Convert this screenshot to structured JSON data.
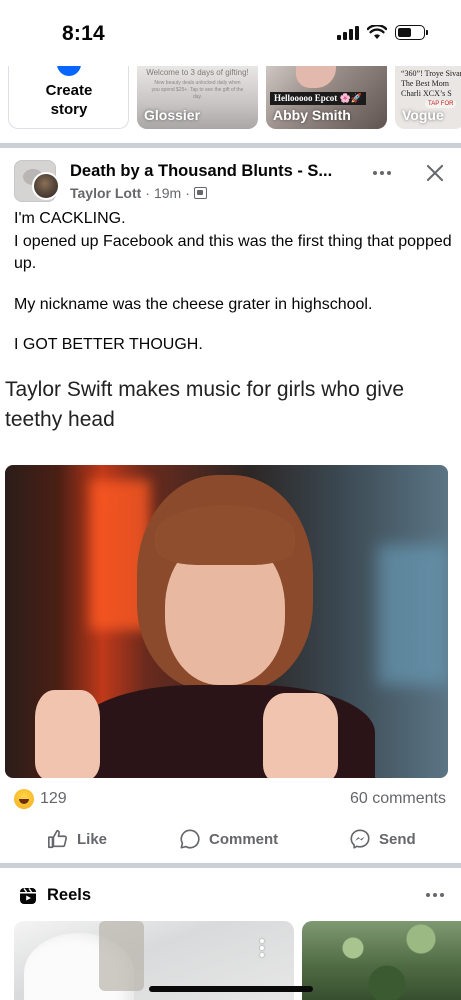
{
  "status_bar": {
    "time": "8:14",
    "battery_level": 0.55
  },
  "stories": {
    "create_label": "Create story",
    "items": [
      {
        "name": "Glossier",
        "promo_text": "Welcome to 3 days of gifting!",
        "promo_small": "New beauty deals unlocked daily when you spend $25+. Tap to see the gift of the day."
      },
      {
        "name": "Abby Smith",
        "tag_text": "Hellooooo Epcot 🌸🚀"
      },
      {
        "name": "Vogue",
        "headline": "“360”! Troye Sivan The Best Mom Charli XCX’s S",
        "tap_label": "TAP FOR"
      }
    ]
  },
  "post": {
    "title": "Death by a Thousand Blunts - S...",
    "author": "Taylor Lott",
    "time": "19m",
    "body": [
      "I'm CACKLING.",
      "I opened up Facebook and this was the first thing that popped up.",
      "",
      "My nickname was the cheese grater in highschool.",
      "",
      "I GOT BETTER THOUGH."
    ],
    "meme_caption": "Taylor Swift makes music for girls who give teethy head",
    "reaction_count": "129",
    "comments_count": "60 comments",
    "actions": {
      "like": "Like",
      "comment": "Comment",
      "send": "Send"
    }
  },
  "reels": {
    "title": "Reels"
  },
  "colors": {
    "brand_blue": "#0866ff",
    "secondary_text": "#65676b",
    "divider": "#cbd0d6",
    "reaction_yellow": "#f7b928"
  }
}
